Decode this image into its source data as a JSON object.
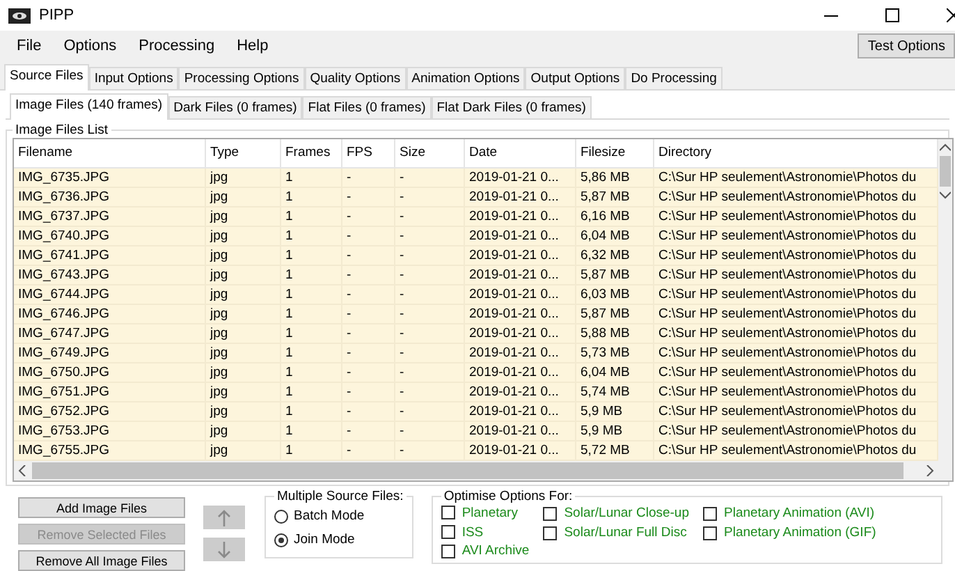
{
  "window": {
    "title": "PIPP"
  },
  "menu": [
    "File",
    "Options",
    "Processing",
    "Help"
  ],
  "test_button": "Test Options",
  "tabs": [
    {
      "label": "Source Files",
      "selected": true
    },
    {
      "label": "Input Options",
      "selected": false
    },
    {
      "label": "Processing Options",
      "selected": false
    },
    {
      "label": "Quality Options",
      "selected": false
    },
    {
      "label": "Animation Options",
      "selected": false
    },
    {
      "label": "Output Options",
      "selected": false
    },
    {
      "label": "Do Processing",
      "selected": false
    }
  ],
  "subtabs": [
    {
      "label": "Image Files (140 frames)",
      "selected": true
    },
    {
      "label": "Dark Files (0 frames)",
      "selected": false
    },
    {
      "label": "Flat Files (0 frames)",
      "selected": false
    },
    {
      "label": "Flat Dark Files (0 frames)",
      "selected": false
    }
  ],
  "group_title": "Image Files List",
  "table": {
    "columns": [
      "Filename",
      "Type",
      "Frames",
      "FPS",
      "Size",
      "Date",
      "Filesize",
      "Directory"
    ],
    "rows": [
      [
        "IMG_6735.JPG",
        "jpg",
        "1",
        "-",
        "-",
        "2019-01-21 0...",
        "5,86 MB",
        "C:\\Sur HP seulement\\Astronomie\\Photos du"
      ],
      [
        "IMG_6736.JPG",
        "jpg",
        "1",
        "-",
        "-",
        "2019-01-21 0...",
        "5,87 MB",
        "C:\\Sur HP seulement\\Astronomie\\Photos du"
      ],
      [
        "IMG_6737.JPG",
        "jpg",
        "1",
        "-",
        "-",
        "2019-01-21 0...",
        "6,16 MB",
        "C:\\Sur HP seulement\\Astronomie\\Photos du"
      ],
      [
        "IMG_6740.JPG",
        "jpg",
        "1",
        "-",
        "-",
        "2019-01-21 0...",
        "6,04 MB",
        "C:\\Sur HP seulement\\Astronomie\\Photos du"
      ],
      [
        "IMG_6741.JPG",
        "jpg",
        "1",
        "-",
        "-",
        "2019-01-21 0...",
        "6,32 MB",
        "C:\\Sur HP seulement\\Astronomie\\Photos du"
      ],
      [
        "IMG_6743.JPG",
        "jpg",
        "1",
        "-",
        "-",
        "2019-01-21 0...",
        "5,87 MB",
        "C:\\Sur HP seulement\\Astronomie\\Photos du"
      ],
      [
        "IMG_6744.JPG",
        "jpg",
        "1",
        "-",
        "-",
        "2019-01-21 0...",
        "6,03 MB",
        "C:\\Sur HP seulement\\Astronomie\\Photos du"
      ],
      [
        "IMG_6746.JPG",
        "jpg",
        "1",
        "-",
        "-",
        "2019-01-21 0...",
        "5,87 MB",
        "C:\\Sur HP seulement\\Astronomie\\Photos du"
      ],
      [
        "IMG_6747.JPG",
        "jpg",
        "1",
        "-",
        "-",
        "2019-01-21 0...",
        "5,88 MB",
        "C:\\Sur HP seulement\\Astronomie\\Photos du"
      ],
      [
        "IMG_6749.JPG",
        "jpg",
        "1",
        "-",
        "-",
        "2019-01-21 0...",
        "5,73 MB",
        "C:\\Sur HP seulement\\Astronomie\\Photos du"
      ],
      [
        "IMG_6750.JPG",
        "jpg",
        "1",
        "-",
        "-",
        "2019-01-21 0...",
        "6,04 MB",
        "C:\\Sur HP seulement\\Astronomie\\Photos du"
      ],
      [
        "IMG_6751.JPG",
        "jpg",
        "1",
        "-",
        "-",
        "2019-01-21 0...",
        "5,74 MB",
        "C:\\Sur HP seulement\\Astronomie\\Photos du"
      ],
      [
        "IMG_6752.JPG",
        "jpg",
        "1",
        "-",
        "-",
        "2019-01-21 0...",
        "5,9 MB",
        "C:\\Sur HP seulement\\Astronomie\\Photos du"
      ],
      [
        "IMG_6753.JPG",
        "jpg",
        "1",
        "-",
        "-",
        "2019-01-21 0...",
        "5,9 MB",
        "C:\\Sur HP seulement\\Astronomie\\Photos du"
      ],
      [
        "IMG_6755.JPG",
        "jpg",
        "1",
        "-",
        "-",
        "2019-01-21 0...",
        "5,72 MB",
        "C:\\Sur HP seulement\\Astronomie\\Photos du"
      ]
    ]
  },
  "file_buttons": [
    {
      "label": "Add Image Files",
      "disabled": false
    },
    {
      "label": "Remove Selected Files",
      "disabled": true
    },
    {
      "label": "Remove All Image Files",
      "disabled": false
    }
  ],
  "move_buttons": [
    {
      "kind": "up",
      "disabled": true
    },
    {
      "kind": "down",
      "disabled": true
    }
  ],
  "multiple_source": {
    "title": "Multiple Source Files:",
    "options": [
      {
        "label": "Batch Mode",
        "selected": false
      },
      {
        "label": "Join Mode",
        "selected": true
      }
    ]
  },
  "optimise": {
    "title": "Optimise Options For:",
    "columns": [
      [
        {
          "label": "Planetary",
          "checked": false
        },
        {
          "label": "ISS",
          "checked": false
        },
        {
          "label": "AVI Archive",
          "checked": false
        }
      ],
      [
        {
          "label": "Solar/Lunar Close-up",
          "checked": false
        },
        {
          "label": "Solar/Lunar Full Disc",
          "checked": false
        }
      ],
      [
        {
          "label": "Planetary Animation (AVI)",
          "checked": false
        },
        {
          "label": "Planetary Animation (GIF)",
          "checked": false
        }
      ]
    ]
  }
}
